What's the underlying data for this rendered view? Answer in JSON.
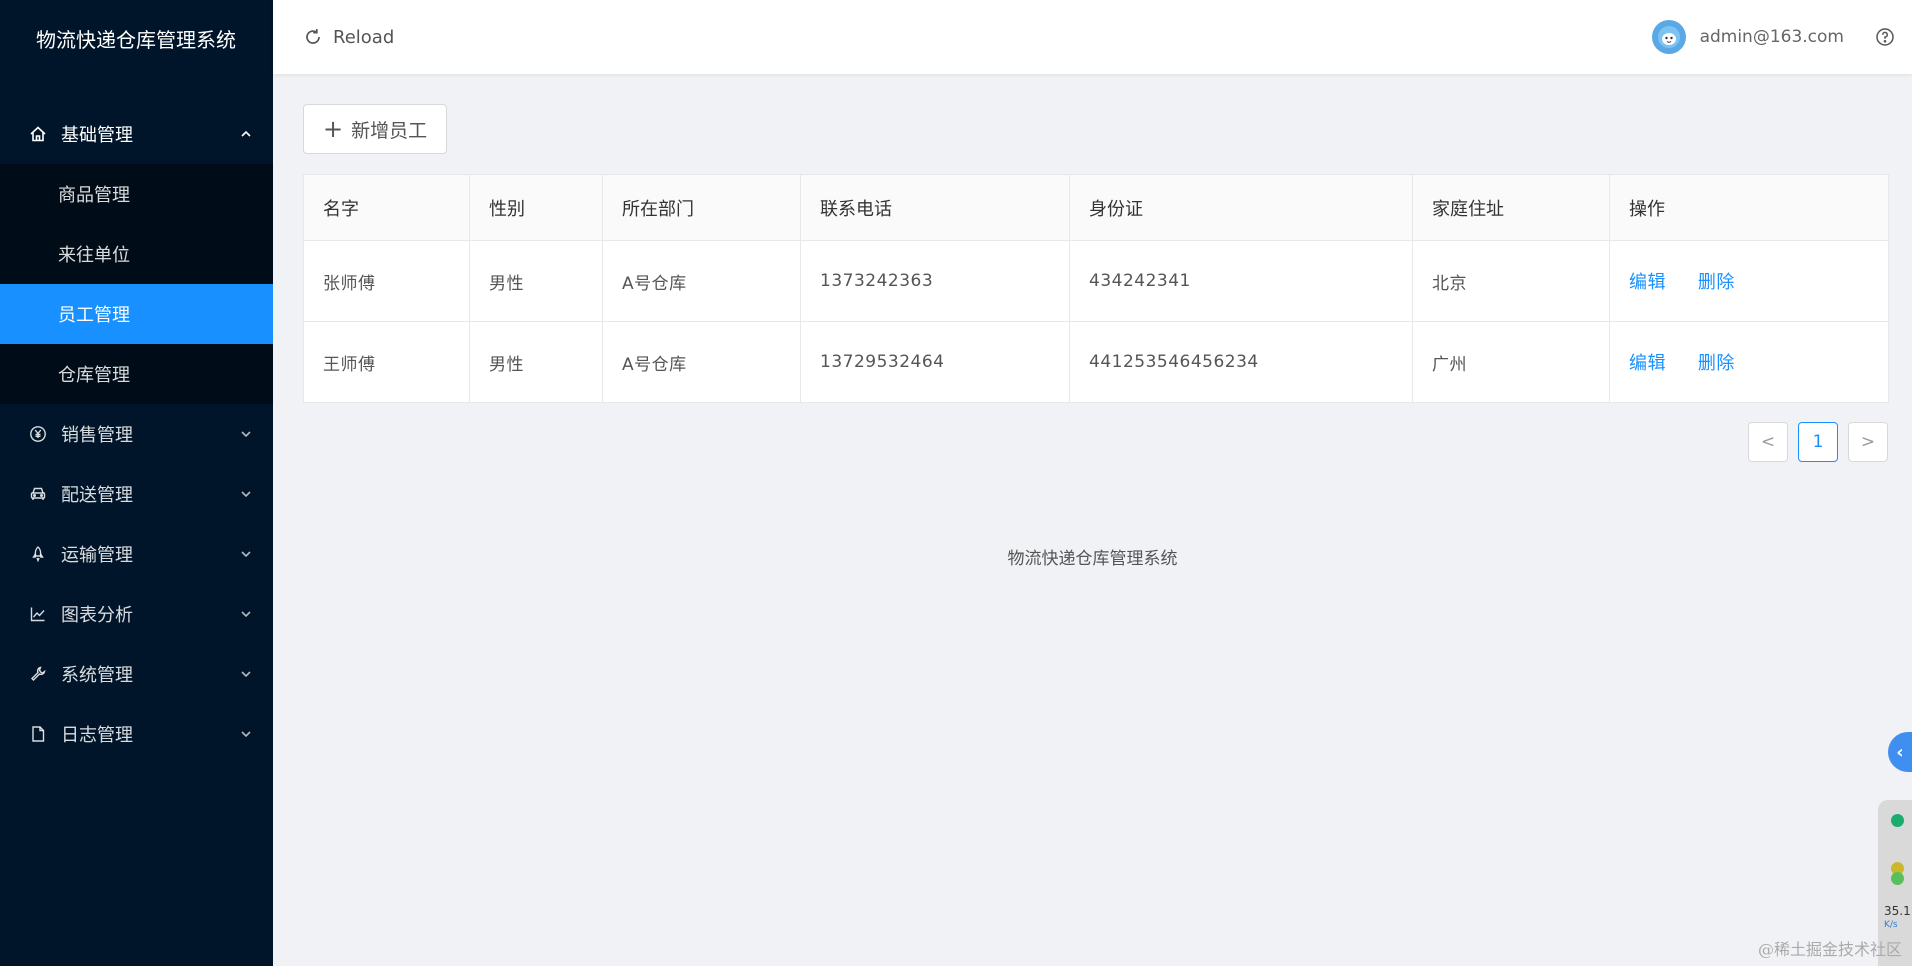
{
  "app": {
    "title": "物流快递仓库管理系统"
  },
  "sidebar": {
    "menus": [
      {
        "label": "基础管理",
        "icon": "home-icon",
        "open": true,
        "children": [
          {
            "label": "商品管理"
          },
          {
            "label": "来往单位"
          },
          {
            "label": "员工管理",
            "active": true
          },
          {
            "label": "仓库管理"
          }
        ]
      },
      {
        "label": "销售管理",
        "icon": "yen-circle-icon"
      },
      {
        "label": "配送管理",
        "icon": "car-icon"
      },
      {
        "label": "运输管理",
        "icon": "rocket-icon"
      },
      {
        "label": "图表分析",
        "icon": "line-chart-icon"
      },
      {
        "label": "系统管理",
        "icon": "wrench-icon"
      },
      {
        "label": "日志管理",
        "icon": "file-icon"
      }
    ]
  },
  "header": {
    "reload_label": "Reload",
    "user_email": "admin@163.com"
  },
  "toolbar": {
    "add_label": "新增员工",
    "add_symbol": "+"
  },
  "table": {
    "columns": [
      "名字",
      "性别",
      "所在部门",
      "联系电话",
      "身份证",
      "家庭住址",
      "操作"
    ],
    "rows": [
      {
        "name": "张师傅",
        "gender": "男性",
        "dept": "A号仓库",
        "phone": "1373242363",
        "id_card": "434242341",
        "address": "北京",
        "edit": "编辑",
        "delete": "删除"
      },
      {
        "name": "王师傅",
        "gender": "男性",
        "dept": "A号仓库",
        "phone": "13729532464",
        "id_card": "441253546456234",
        "address": "广州",
        "edit": "编辑",
        "delete": "删除"
      }
    ]
  },
  "pagination": {
    "current_page": "1",
    "prev_symbol": "<",
    "next_symbol": ">"
  },
  "footer": {
    "text": "物流快递仓库管理系统"
  },
  "overlay": {
    "float_symbol": "‹",
    "monitor_value": "35.1",
    "monitor_unit": "K/s",
    "watermark": "@稀土掘金技术社区"
  },
  "colors": {
    "sidebar_bg": "#001529",
    "submenu_bg": "#000c17",
    "accent": "#1890ff"
  }
}
